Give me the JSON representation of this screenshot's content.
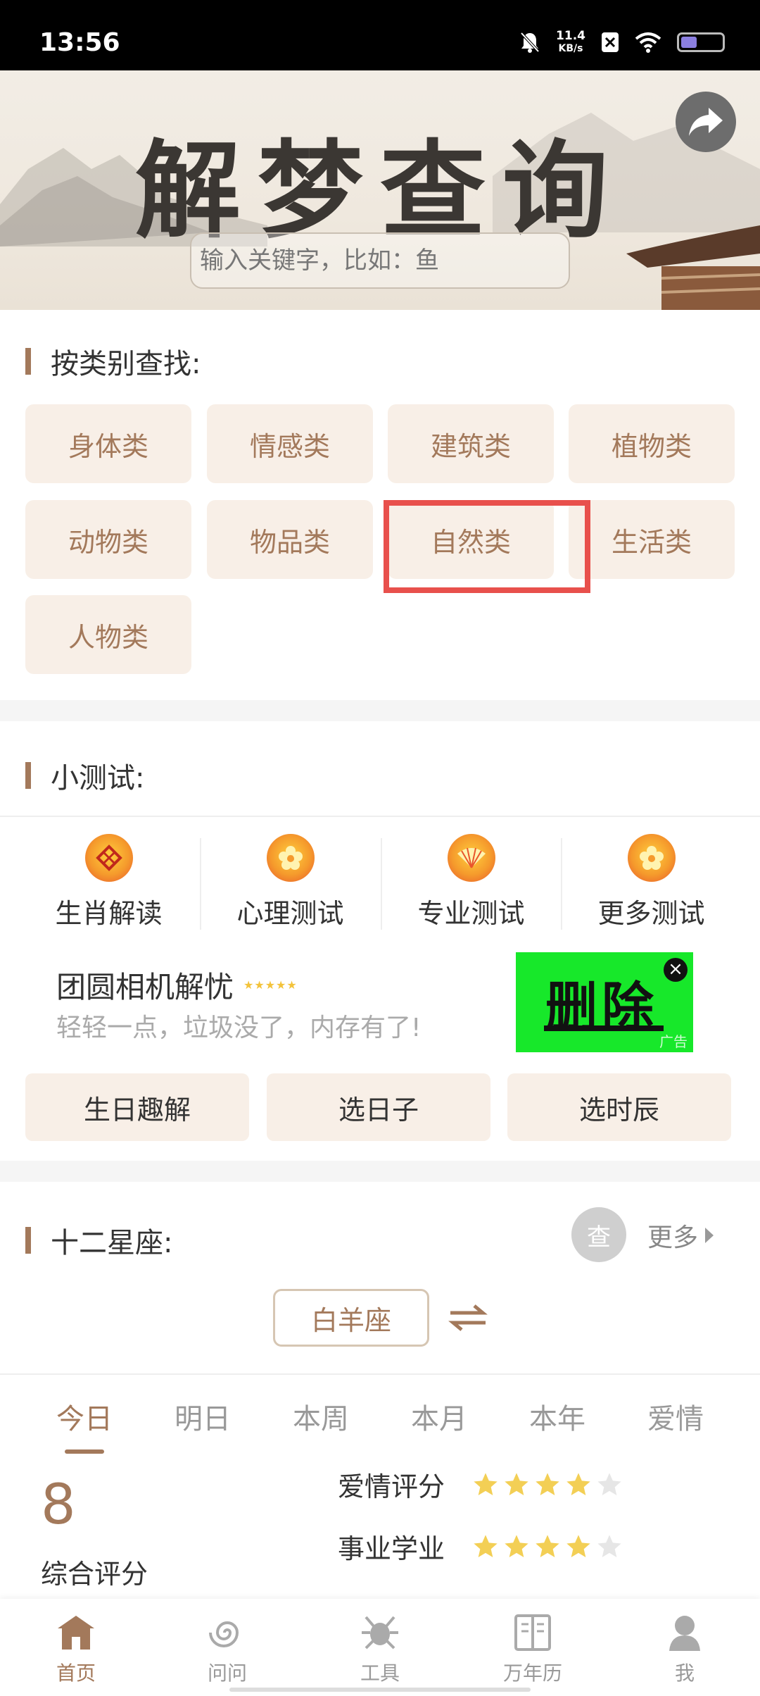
{
  "status_bar": {
    "time": "13:56",
    "net_speed": "11.4",
    "net_unit": "KB/s"
  },
  "banner": {
    "title": "解梦查询",
    "search_placeholder": "输入关键字，比如：鱼"
  },
  "categories": {
    "title": "按类别查找:",
    "items": [
      "身体类",
      "情感类",
      "建筑类",
      "植物类",
      "动物类",
      "物品类",
      "自然类",
      "生活类",
      "人物类"
    ]
  },
  "tests": {
    "title": "小测试:",
    "items": [
      "生肖解读",
      "心理测试",
      "专业测试",
      "更多测试"
    ]
  },
  "ad": {
    "title": "团圆相机解忧",
    "desc": "轻轻一点，垃圾没了，内存有了!",
    "image_text": "删除",
    "tag": "广告"
  },
  "fun_buttons": [
    "生日趣解",
    "选日子",
    "选时辰"
  ],
  "zodiac": {
    "title": "十二星座:",
    "query_label": "查",
    "more_label": "更多",
    "selected_sign": "白羊座",
    "tabs": [
      "今日",
      "明日",
      "本周",
      "本月",
      "本年",
      "爱情"
    ],
    "active_tab": "今日",
    "score": "8",
    "score_label": "综合评分",
    "ratings": [
      {
        "label": "爱情评分",
        "stars": 4,
        "max": 5
      },
      {
        "label": "事业学业",
        "stars": 4,
        "max": 5
      }
    ]
  },
  "bottom_nav": {
    "items": [
      "首页",
      "问问",
      "工具",
      "万年历",
      "我"
    ],
    "active": "首页"
  },
  "colors": {
    "accent": "#a3795b",
    "button_bg": "#f8efe7",
    "highlight": "#e8504c",
    "star": "#f3cf55"
  }
}
